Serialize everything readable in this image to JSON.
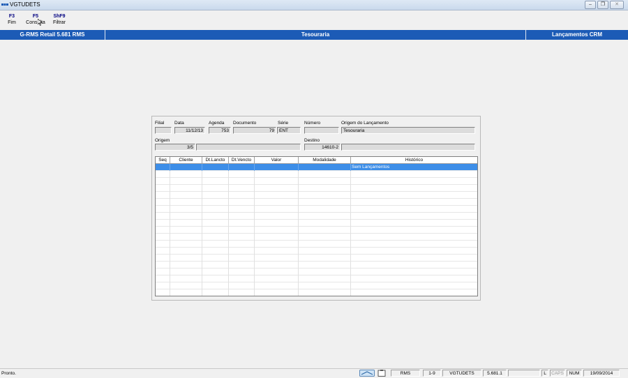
{
  "window": {
    "title": "VGTUDETS"
  },
  "fkeys": [
    {
      "key": "F3",
      "label": "Fim"
    },
    {
      "key": "F5",
      "label": "Consulta"
    },
    {
      "key": "ShF9",
      "label": "Filtrar"
    }
  ],
  "header": {
    "product": "G-RMS Retail 5.681 RMS",
    "module": "Tesouraria",
    "screen": "Lançamentos CRM"
  },
  "form": {
    "filial": {
      "label": "Filial",
      "value": ""
    },
    "data": {
      "label": "Data",
      "value": "11/12/13"
    },
    "agenda": {
      "label": "Agenda",
      "value": "753"
    },
    "documento": {
      "label": "Documento",
      "value": "79"
    },
    "serie": {
      "label": "Série",
      "value": "ENT"
    },
    "numero": {
      "label": "Número",
      "value": ""
    },
    "origem_lancamento": {
      "label": "Origem do Lançamento",
      "value": "Tesouraria"
    },
    "origem": {
      "label": "Origem",
      "code": "3/5",
      "desc": ""
    },
    "destino": {
      "label": "Destino",
      "code": "14610-2",
      "desc": ""
    }
  },
  "grid": {
    "columns": [
      "Seq",
      "Cliente",
      "Dt.Lancto",
      "Dt.Vencto",
      "Valor",
      "Modalidade",
      "Histórico"
    ],
    "rows": [
      {
        "seq": "",
        "cliente": "",
        "dt_lancto": "",
        "dt_vencto": "",
        "valor": "",
        "modalidade": "",
        "historico": "Sem Lançamentos",
        "selected": true
      }
    ]
  },
  "status": {
    "message": "Pronto.",
    "panels": [
      "RMS",
      "1-9",
      "VGTUDETS",
      "5.681.1",
      "",
      "L",
      "CAPS",
      "NUM",
      "19/09/2014"
    ]
  },
  "colors": {
    "header_bg": "#1c5bb6",
    "selection": "#3d8ee8"
  }
}
